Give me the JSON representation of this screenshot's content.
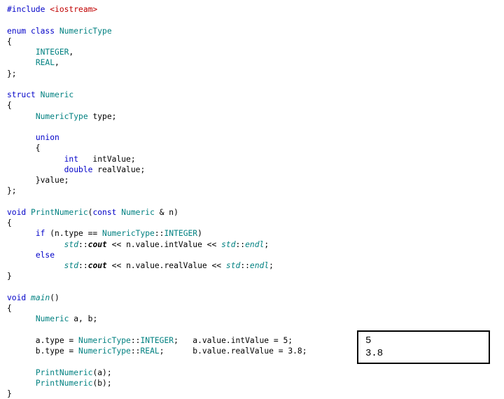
{
  "code": {
    "l01a": "#include ",
    "l01b": "<iostream>",
    "l02": "",
    "l03a": "enum ",
    "l03b": "class ",
    "l03c": "NumericType",
    "l04": "{",
    "l05a": "      ",
    "l05b": "INTEGER",
    "l05c": ",",
    "l06a": "      ",
    "l06b": "REAL",
    "l06c": ",",
    "l07": "};",
    "l08": "",
    "l09a": "struct ",
    "l09b": "Numeric",
    "l10": "{",
    "l11a": "      ",
    "l11b": "NumericType ",
    "l11c": "type;",
    "l12": "",
    "l13a": "      ",
    "l13b": "union",
    "l14": "      {",
    "l15a": "            ",
    "l15b": "int",
    "l15c": "   intValue;",
    "l16a": "            ",
    "l16b": "double ",
    "l16c": "realValue;",
    "l17": "      }value;",
    "l18": "};",
    "l19": "",
    "l20a": "void ",
    "l20b": "PrintNumeric",
    "l20c": "(",
    "l20d": "const ",
    "l20e": "Numeric ",
    "l20f": "& n)",
    "l21": "{",
    "l22a": "      ",
    "l22b": "if ",
    "l22c": "(n.type == ",
    "l22d": "NumericType",
    "l22e": "::",
    "l22f": "INTEGER",
    "l22g": ")",
    "l23a": "            ",
    "l23b": "std",
    "l23c": "::",
    "l23d": "cout",
    "l23e": " << n.value.intValue << ",
    "l23f": "std",
    "l23g": "::",
    "l23h": "endl",
    "l23i": ";",
    "l24a": "      ",
    "l24b": "else",
    "l25a": "            ",
    "l25b": "std",
    "l25c": "::",
    "l25d": "cout",
    "l25e": " << n.value.realValue << ",
    "l25f": "std",
    "l25g": "::",
    "l25h": "endl",
    "l25i": ";",
    "l26": "}",
    "l27": "",
    "l28a": "void ",
    "l28b": "main",
    "l28c": "()",
    "l29": "{",
    "l30a": "      ",
    "l30b": "Numeric ",
    "l30c": "a, b;",
    "l31": "",
    "l32a": "      a.type = ",
    "l32b": "NumericType",
    "l32c": "::",
    "l32d": "INTEGER",
    "l32e": ";   a.value.intValue = 5;",
    "l33a": "      b.type = ",
    "l33b": "NumericType",
    "l33c": "::",
    "l33d": "REAL",
    "l33e": ";      b.value.realValue = 3.8;",
    "l34": "",
    "l35a": "      ",
    "l35b": "PrintNumeric",
    "l35c": "(a);",
    "l36a": "      ",
    "l36b": "PrintNumeric",
    "l36c": "(b);",
    "l37": "}"
  },
  "output": {
    "line1": "5",
    "line2": "3.8"
  }
}
